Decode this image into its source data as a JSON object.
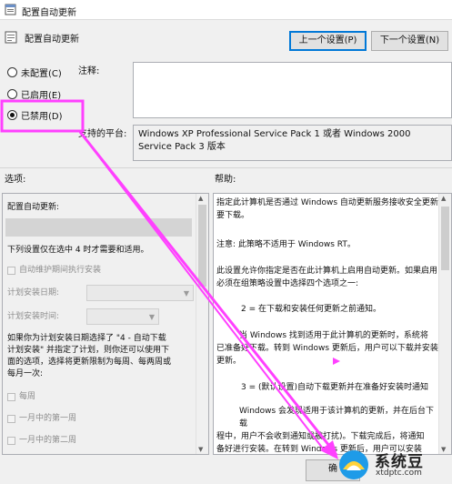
{
  "window": {
    "title": "配置自动更新"
  },
  "policy": {
    "title": "配置自动更新"
  },
  "nav": {
    "prev_label": "上一个设置(P)",
    "next_label": "下一个设置(N)"
  },
  "radios": [
    {
      "label": "未配置(C)",
      "checked": false
    },
    {
      "label": "已启用(E)",
      "checked": false
    },
    {
      "label": "已禁用(D)",
      "checked": true
    }
  ],
  "comment": {
    "label": "注释:",
    "value": ""
  },
  "platform": {
    "label": "支持的平台:",
    "text": "Windows XP Professional Service Pack 1 或者 Windows 2000 Service Pack 3 版本",
    "line2": "版本"
  },
  "sections": {
    "options_label": "选项:",
    "help_label": "帮助:"
  },
  "options": {
    "heading": "配置自动更新:",
    "note": "下列设置仅在选中 4 时才需要和适用。",
    "maintenance_checkbox": "自动维护期间执行安装",
    "schedule_day_label": "计划安装日期:",
    "schedule_time_label": "计划安装时间:",
    "description": [
      "如果你为计划安装日期选择了 \"4 - 自动下载",
      "计划安装\" 并指定了计划，则你还可以使用下",
      "面的选项，选择将更新限制为每周、每两周或",
      "每月一次:"
    ],
    "weekly": "每周",
    "first_week": "一月中的第一周",
    "second_week": "一月中的第二周"
  },
  "help": {
    "p1": [
      "指定此计算机是否通过 Windows 自动更新服务接收安全更新",
      "要下载。"
    ],
    "p2": "注意: 此策略不适用于 Windows RT。",
    "p3": [
      "此设置允许你指定是否在此计算机上启用自动更新。如果启用",
      "必须在组策略设置中选择四个选项之一:"
    ],
    "p4": "2 = 在下载和安装任何更新之前通知。",
    "p5": [
      "当 Windows 找到适用于此计算机的更新时，系统将",
      "已准备好下载。转到 Windows 更新后，用户可以下载并安装",
      "更新。"
    ],
    "p6": "3 = (默认设置)自动下载更新并在准备好安装时通知",
    "p7": [
      "Windows 会发现适用于该计算机的更新，并在后台下载",
      "程中，用户不会收到通知或被打扰)。下载完成后，将通知",
      "备好进行安装。在转到 Windows 更新后，用户可以安装"
    ]
  },
  "watermark": {
    "name": "系统豆",
    "url": "xtdptc.com",
    "cut_text": "确"
  },
  "colors": {
    "annotation": "#ff40ff",
    "accent": "#0078d7"
  }
}
